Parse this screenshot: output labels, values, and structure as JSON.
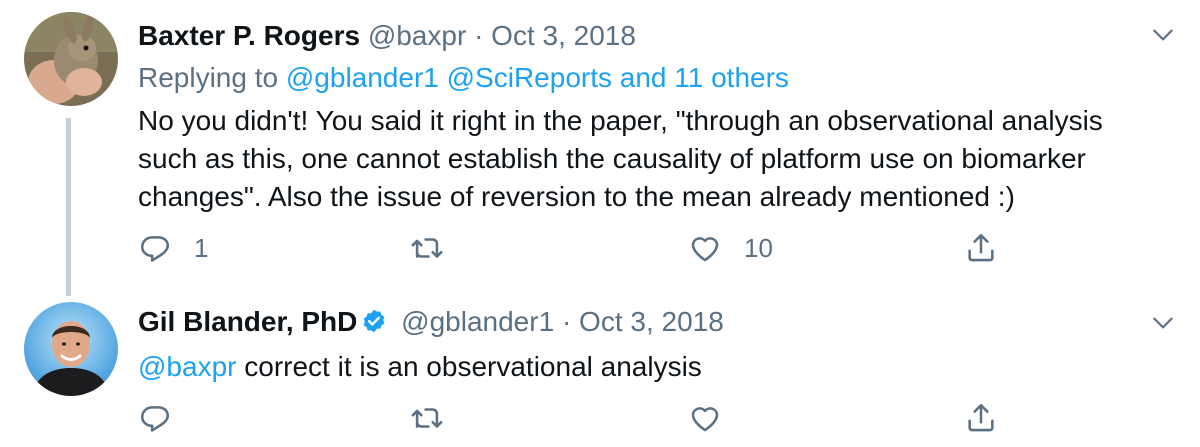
{
  "tweets": [
    {
      "display_name": "Baxter P. Rogers",
      "handle": "@baxpr",
      "separator": "·",
      "date": "Oct 3, 2018",
      "replying_to_prefix": "Replying to",
      "replying_to_mentions": "@gblander1 @SciReports and 11 others",
      "text": "No you didn't! You said it right in the paper, \"through an observational analysis such as this, one cannot establish the causality of platform use on biomarker changes\". Also the issue of reversion to the mean already mentioned :)",
      "reply_count": "1",
      "retweet_count": "",
      "like_count": "10",
      "avatar_icon": "rabbit-photo-avatar"
    },
    {
      "display_name": "Gil Blander, PhD",
      "verified": true,
      "handle": "@gblander1",
      "separator": "·",
      "date": "Oct 3, 2018",
      "mention": "@baxpr",
      "text": "correct it is an observational analysis",
      "reply_count": "",
      "retweet_count": "",
      "like_count": "",
      "avatar_icon": "person-photo-avatar"
    }
  ],
  "colors": {
    "link": "#1da1f2",
    "meta": "#5b7083",
    "text": "#0f1419",
    "thread_line": "#c4cfd6",
    "verified": "#1da1f2"
  }
}
